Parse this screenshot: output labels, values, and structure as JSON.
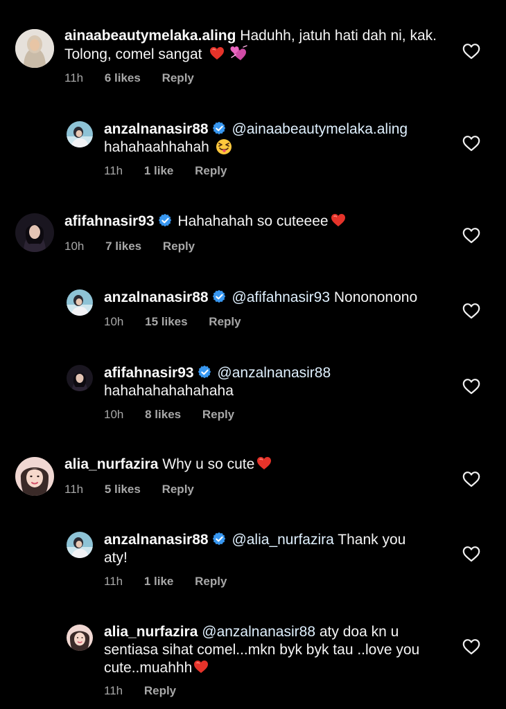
{
  "colors": {
    "background": "#000000",
    "text": "#f5f5f5",
    "meta": "#a8a8a8",
    "mention": "#e0f1ff",
    "verified": "#3897f0",
    "heart_emoji": "#e5332a",
    "double_heart_emoji": "#e455b5"
  },
  "icons": {
    "like": "heart-outline-icon",
    "verified": "verified-badge-icon"
  },
  "comments": [
    {
      "username": "ainaabeautymelaka.aling",
      "verified": false,
      "mention": "",
      "text": "Haduhh, jatuh hati dah ni, kak. Tolong, comel sangat",
      "emoji": [
        "red-heart-emoji",
        "two-hearts-emoji"
      ],
      "time": "11h",
      "likes": "6 likes",
      "reply": "Reply"
    },
    {
      "username": "anzalnanasir88",
      "verified": true,
      "mention": "@ainaabeautymelaka.aling",
      "text": "hahahaahhahah",
      "emoji": [
        "squinting-tongue-emoji"
      ],
      "time": "11h",
      "likes": "1 like",
      "reply": "Reply"
    },
    {
      "username": "afifahnasir93",
      "verified": true,
      "mention": "",
      "text": "Hahahahah so cuteeee",
      "emoji": [
        "red-heart-emoji"
      ],
      "time": "10h",
      "likes": "7 likes",
      "reply": "Reply"
    },
    {
      "username": "anzalnanasir88",
      "verified": true,
      "mention": "@afifahnasir93",
      "text": "Nonononono",
      "emoji": [],
      "time": "10h",
      "likes": "15 likes",
      "reply": "Reply"
    },
    {
      "username": "afifahnasir93",
      "verified": true,
      "mention": "@anzalnanasir88",
      "text": "hahahahahahahaha",
      "emoji": [],
      "time": "10h",
      "likes": "8 likes",
      "reply": "Reply"
    },
    {
      "username": "alia_nurfazira",
      "verified": false,
      "mention": "",
      "text": "Why u so cute",
      "emoji": [
        "red-heart-emoji"
      ],
      "time": "11h",
      "likes": "5 likes",
      "reply": "Reply"
    },
    {
      "username": "anzalnanasir88",
      "verified": true,
      "mention": "@alia_nurfazira",
      "text": "Thank you aty!",
      "emoji": [],
      "time": "11h",
      "likes": "1 like",
      "reply": "Reply"
    },
    {
      "username": "alia_nurfazira",
      "verified": false,
      "mention": "@anzalnanasir88",
      "text": "aty doa kn u sentiasa sihat comel...mkn byk byk tau ..love you cute..muahhh",
      "emoji": [
        "red-heart-emoji"
      ],
      "time": "11h",
      "likes": "",
      "reply": "Reply"
    }
  ]
}
